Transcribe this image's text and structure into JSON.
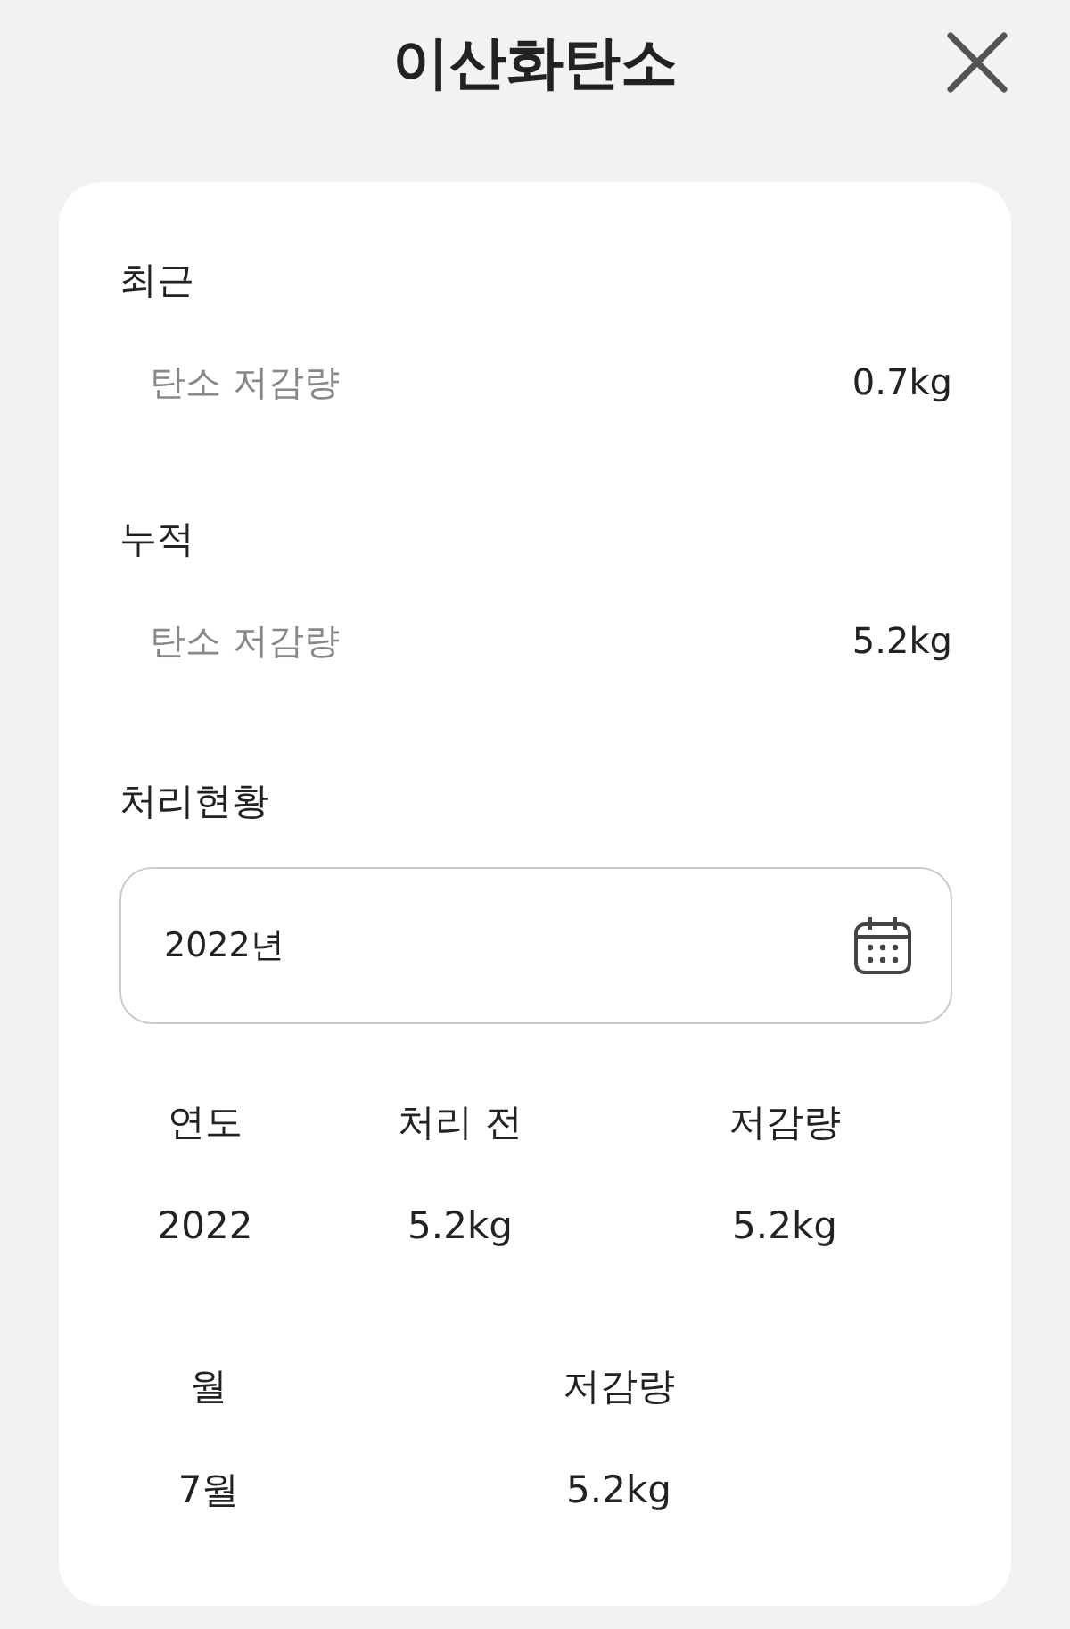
{
  "header": {
    "title": "이산화탄소"
  },
  "sections": [
    {
      "heading": "최근",
      "rows": [
        {
          "label": "탄소 저감량",
          "value": "0.7kg"
        }
      ]
    },
    {
      "heading": "누적",
      "rows": [
        {
          "label": "탄소 저감량",
          "value": "5.2kg"
        }
      ]
    }
  ],
  "status": {
    "heading": "처리현황",
    "date_field": {
      "value": "2022년"
    },
    "tables": [
      {
        "columns": [
          "연도",
          "처리 전",
          "저감량"
        ],
        "rows": [
          [
            "2022",
            "5.2kg",
            "5.2kg"
          ]
        ]
      },
      {
        "columns": [
          "월",
          "저감량"
        ],
        "rows": [
          [
            "7월",
            "5.2kg"
          ]
        ]
      }
    ]
  }
}
